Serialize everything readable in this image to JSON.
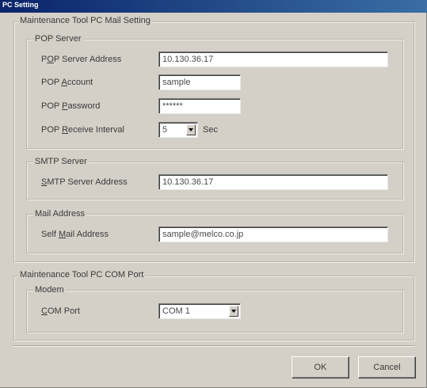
{
  "window": {
    "title": "PC Setting"
  },
  "mail_group": {
    "legend": "Maintenance Tool PC Mail Setting",
    "pop": {
      "legend": "POP Server",
      "server_address": {
        "label_pre": "P",
        "label_ul": "O",
        "label_post": "P Server Address",
        "value": "10.130.36.17"
      },
      "account": {
        "label_pre": "POP ",
        "label_ul": "A",
        "label_post": "ccount",
        "value": "sample"
      },
      "password": {
        "label_pre": "POP ",
        "label_ul": "P",
        "label_post": "assword",
        "value": "******"
      },
      "receive_interval": {
        "label_pre": "POP ",
        "label_ul": "R",
        "label_post": "eceive Interval",
        "value": "5",
        "unit": "Sec"
      }
    },
    "smtp": {
      "legend": "SMTP Server",
      "server_address": {
        "label_pre": "",
        "label_ul": "S",
        "label_post": "MTP Server Address",
        "value": "10.130.36.17"
      }
    },
    "mail_address": {
      "legend": "Mail Address",
      "self": {
        "label_pre": "Self ",
        "label_ul": "M",
        "label_post": "ail Address",
        "value": "sample@melco.co.jp"
      }
    }
  },
  "com_group": {
    "legend": "Maintenance Tool PC COM Port",
    "modem": {
      "legend": "Modem",
      "com_port": {
        "label_pre": "",
        "label_ul": "C",
        "label_post": "OM Port",
        "value": "COM 1"
      }
    }
  },
  "buttons": {
    "ok": "OK",
    "cancel": "Cancel"
  }
}
